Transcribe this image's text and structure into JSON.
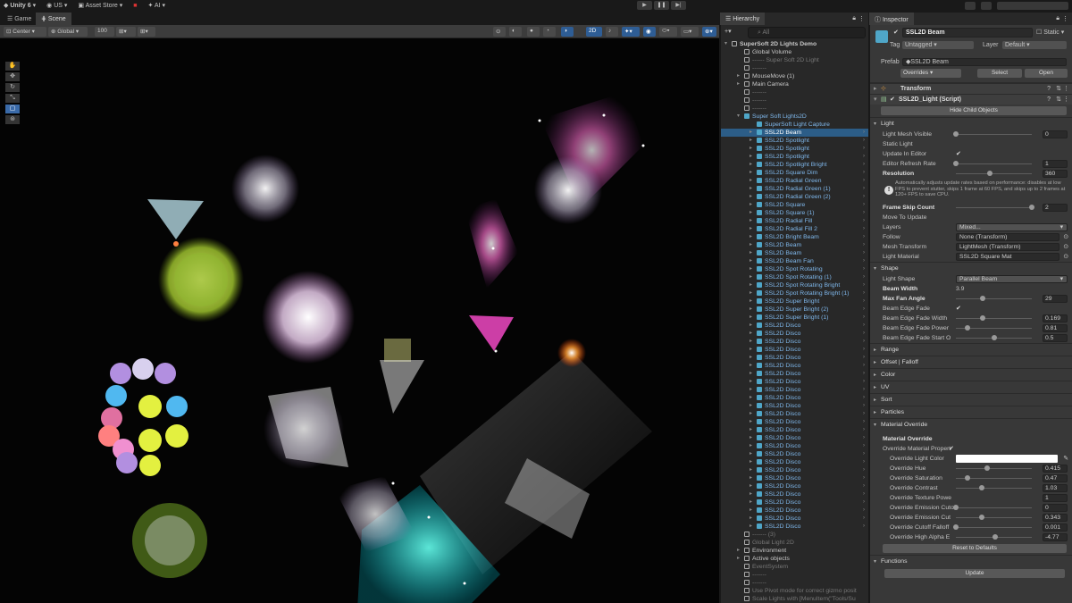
{
  "topbar": {
    "app": "Unity 6",
    "account": "US",
    "store": "Asset Store",
    "ai": "AI"
  },
  "tabs": {
    "game": "Game",
    "scene": "Scene"
  },
  "scene_toolbar": {
    "pivot": "Center",
    "space": "Global",
    "snap": "100",
    "mode2d": "2D"
  },
  "hierarchy": {
    "title": "Hierarchy",
    "search": "All",
    "rows": [
      {
        "t": "SuperSoft 2D Lights Demo",
        "d": 0,
        "k": "scene",
        "s": "root"
      },
      {
        "t": "Global Volume",
        "d": 1,
        "k": "go",
        "s": ""
      },
      {
        "t": "------ Super Soft 2D Light",
        "d": 1,
        "k": "go",
        "s": "gray"
      },
      {
        "t": "-------",
        "d": 1,
        "k": "go",
        "s": "gray"
      },
      {
        "t": "MouseMove (1)",
        "d": 1,
        "k": "go",
        "s": "arrow"
      },
      {
        "t": "Main Camera",
        "d": 1,
        "k": "go",
        "s": "arrow"
      },
      {
        "t": "-------",
        "d": 1,
        "k": "go",
        "s": "gray"
      },
      {
        "t": "-------",
        "d": 1,
        "k": "go",
        "s": "gray"
      },
      {
        "t": "-------",
        "d": 1,
        "k": "go",
        "s": "gray"
      },
      {
        "t": "Super Soft Lights2D",
        "d": 1,
        "k": "pf",
        "s": "blue open"
      },
      {
        "t": "SuperSoft Light Capture",
        "d": 2,
        "k": "pf",
        "s": "blue"
      },
      {
        "t": "SSL2D Beam",
        "d": 2,
        "k": "pf",
        "s": "sel arrow"
      },
      {
        "t": "SSL2D Spotlight",
        "d": 2,
        "k": "pf",
        "s": "blue arrow"
      },
      {
        "t": "SSL2D Spotlight",
        "d": 2,
        "k": "pf",
        "s": "blue arrow"
      },
      {
        "t": "SSL2D Spotlight",
        "d": 2,
        "k": "pf",
        "s": "blue arrow"
      },
      {
        "t": "SSL2D Spotlight Bright",
        "d": 2,
        "k": "pf",
        "s": "blue arrow"
      },
      {
        "t": "SSL2D Square Dim",
        "d": 2,
        "k": "pf",
        "s": "blue arrow"
      },
      {
        "t": "SSL2D Radial Green",
        "d": 2,
        "k": "pf",
        "s": "blue arrow"
      },
      {
        "t": "SSL2D Radial Green (1)",
        "d": 2,
        "k": "pf",
        "s": "blue arrow"
      },
      {
        "t": "SSL2D Radial Green (2)",
        "d": 2,
        "k": "pf",
        "s": "blue arrow"
      },
      {
        "t": "SSL2D Square",
        "d": 2,
        "k": "pf",
        "s": "blue arrow"
      },
      {
        "t": "SSL2D Square (1)",
        "d": 2,
        "k": "pf",
        "s": "blue arrow"
      },
      {
        "t": "SSL2D Radial Fill",
        "d": 2,
        "k": "pf",
        "s": "blue arrow"
      },
      {
        "t": "SSL2D Radial Fill 2",
        "d": 2,
        "k": "pf",
        "s": "blue arrow"
      },
      {
        "t": "SSL2D Bright Beam",
        "d": 2,
        "k": "pf",
        "s": "blue arrow"
      },
      {
        "t": "SSL2D Beam",
        "d": 2,
        "k": "pf",
        "s": "blue arrow"
      },
      {
        "t": "SSL2D Beam",
        "d": 2,
        "k": "pf",
        "s": "blue arrow"
      },
      {
        "t": "SSL2D Beam Fan",
        "d": 2,
        "k": "pf",
        "s": "blue arrow"
      },
      {
        "t": "SSL2D Spot Rotating",
        "d": 2,
        "k": "pf",
        "s": "blue arrow"
      },
      {
        "t": "SSL2D Spot Rotating (1)",
        "d": 2,
        "k": "pf",
        "s": "blue arrow"
      },
      {
        "t": "SSL2D Spot Rotating Bright",
        "d": 2,
        "k": "pf",
        "s": "blue arrow"
      },
      {
        "t": "SSL2D Spot Rotating Bright (1)",
        "d": 2,
        "k": "pf",
        "s": "blue arrow"
      },
      {
        "t": "SSL2D Super Bright",
        "d": 2,
        "k": "pf",
        "s": "blue arrow"
      },
      {
        "t": "SSL2D Super Bright (2)",
        "d": 2,
        "k": "pf",
        "s": "blue arrow"
      },
      {
        "t": "SSL2D Super Bright (1)",
        "d": 2,
        "k": "pf",
        "s": "blue arrow"
      },
      {
        "t": "SSL2D Disco",
        "d": 2,
        "k": "pf",
        "s": "blue arrow"
      },
      {
        "t": "SSL2D Disco",
        "d": 2,
        "k": "pf",
        "s": "blue arrow"
      },
      {
        "t": "SSL2D Disco",
        "d": 2,
        "k": "pf",
        "s": "blue arrow"
      },
      {
        "t": "SSL2D Disco",
        "d": 2,
        "k": "pf",
        "s": "blue arrow"
      },
      {
        "t": "SSL2D Disco",
        "d": 2,
        "k": "pf",
        "s": "blue arrow"
      },
      {
        "t": "SSL2D Disco",
        "d": 2,
        "k": "pf",
        "s": "blue arrow"
      },
      {
        "t": "SSL2D Disco",
        "d": 2,
        "k": "pf",
        "s": "blue arrow"
      },
      {
        "t": "SSL2D Disco",
        "d": 2,
        "k": "pf",
        "s": "blue arrow"
      },
      {
        "t": "SSL2D Disco",
        "d": 2,
        "k": "pf",
        "s": "blue arrow"
      },
      {
        "t": "SSL2D Disco",
        "d": 2,
        "k": "pf",
        "s": "blue arrow"
      },
      {
        "t": "SSL2D Disco",
        "d": 2,
        "k": "pf",
        "s": "blue arrow"
      },
      {
        "t": "SSL2D Disco",
        "d": 2,
        "k": "pf",
        "s": "blue arrow"
      },
      {
        "t": "SSL2D Disco",
        "d": 2,
        "k": "pf",
        "s": "blue arrow"
      },
      {
        "t": "SSL2D Disco",
        "d": 2,
        "k": "pf",
        "s": "blue arrow"
      },
      {
        "t": "SSL2D Disco",
        "d": 2,
        "k": "pf",
        "s": "blue arrow"
      },
      {
        "t": "SSL2D Disco",
        "d": 2,
        "k": "pf",
        "s": "blue arrow"
      },
      {
        "t": "SSL2D Disco",
        "d": 2,
        "k": "pf",
        "s": "blue arrow"
      },
      {
        "t": "SSL2D Disco",
        "d": 2,
        "k": "pf",
        "s": "blue arrow"
      },
      {
        "t": "SSL2D Disco",
        "d": 2,
        "k": "pf",
        "s": "blue arrow"
      },
      {
        "t": "SSL2D Disco",
        "d": 2,
        "k": "pf",
        "s": "blue arrow"
      },
      {
        "t": "SSL2D Disco",
        "d": 2,
        "k": "pf",
        "s": "blue arrow"
      },
      {
        "t": "SSL2D Disco",
        "d": 2,
        "k": "pf",
        "s": "blue arrow"
      },
      {
        "t": "SSL2D Disco",
        "d": 2,
        "k": "pf",
        "s": "blue arrow"
      },
      {
        "t": "SSL2D Disco",
        "d": 2,
        "k": "pf",
        "s": "blue arrow"
      },
      {
        "t": "SSL2D Disco",
        "d": 2,
        "k": "pf",
        "s": "blue arrow"
      },
      {
        "t": "SSL2D Disco",
        "d": 2,
        "k": "pf",
        "s": "blue arrow"
      },
      {
        "t": "------- (3)",
        "d": 1,
        "k": "go",
        "s": "gray"
      },
      {
        "t": "Global Light 2D",
        "d": 1,
        "k": "go",
        "s": "gray"
      },
      {
        "t": "Environment",
        "d": 1,
        "k": "go",
        "s": "arrow"
      },
      {
        "t": "Active objects",
        "d": 1,
        "k": "go",
        "s": "arrow"
      },
      {
        "t": "EventSystem",
        "d": 1,
        "k": "go",
        "s": "gray"
      },
      {
        "t": "-------",
        "d": 1,
        "k": "go",
        "s": "gray"
      },
      {
        "t": "-------",
        "d": 1,
        "k": "go",
        "s": "gray"
      },
      {
        "t": "Use Pivot mode for correct gizmo posit",
        "d": 1,
        "k": "go",
        "s": "gray"
      },
      {
        "t": "Scale Lights with [MenuItem(\"Tools/Su",
        "d": 1,
        "k": "go",
        "s": "gray"
      },
      {
        "t": "-------",
        "d": 1,
        "k": "go",
        "s": "gray"
      }
    ]
  },
  "inspector": {
    "title": "Inspector",
    "obj_name": "SSL2D Beam",
    "static_label": "Static",
    "tag_label": "Tag",
    "tag": "Untagged",
    "layer_label": "Layer",
    "layer": "Default",
    "prefab_label": "Prefab",
    "prefab": "SSL2D Beam",
    "overrides": "Overrides",
    "select": "Select",
    "open": "Open",
    "transform": "Transform",
    "script": "SSL2D_Light (Script)",
    "hide_child": "Hide Child Objects",
    "light_section": "Light",
    "light_mesh_visible": "Light Mesh Visible",
    "light_mesh_visible_v": "0",
    "light_mesh_visible_f": 0.0,
    "static_light": "Static Light",
    "update_in_editor": "Update In Editor",
    "editor_refresh_rate": "Editor Refresh Rate",
    "editor_refresh_rate_v": "1",
    "editor_refresh_rate_f": 0.0,
    "resolution": "Resolution",
    "resolution_v": "360",
    "resolution_f": 0.45,
    "note": "Automatically adjusts update rates based on performance: disables at low FPS to prevent stutter, skips 1 frame at 60 FPS, and skips up to 2 frames at 120+ FPS to save CPU.",
    "frame_skip": "Frame Skip Count",
    "frame_skip_v": "2",
    "frame_skip_f": 1.0,
    "move_to_update": "Move To Update",
    "layers": "Layers",
    "layers_v": "Mixed...",
    "follow": "Follow",
    "follow_v": "None (Transform)",
    "mesh_transform": "Mesh Transform",
    "mesh_transform_v": "LightMesh (Transform)",
    "light_material": "Light Material",
    "light_material_v": "SSL2D Square Mat",
    "shape_section": "Shape",
    "light_shape": "Light Shape",
    "light_shape_v": "Parallel Beam",
    "beam_width": "Beam Width",
    "beam_width_v": "3.9",
    "max_fan": "Max Fan Angle",
    "max_fan_v": "29",
    "max_fan_f": 0.35,
    "beam_edge_fade": "Beam Edge Fade",
    "bef_width": "Beam Edge Fade Width",
    "bef_width_v": "0.169",
    "bef_width_f": 0.35,
    "bef_power": "Beam Edge Fade Power",
    "bef_power_v": "0.81",
    "bef_power_f": 0.15,
    "bef_start": "Beam Edge Fade Start O",
    "bef_start_v": "0.5",
    "bef_start_f": 0.5,
    "range": "Range",
    "offset": "Offset | Falloff",
    "color": "Color",
    "uv": "UV",
    "sort": "Sort",
    "particles": "Particles",
    "mat_override_section": "Material Override",
    "mat_override_sub": "Material Override",
    "override_mat_prop": "Override Material Propert",
    "o_color": "Override Light Color",
    "o_color_hex": "#ffffff",
    "o_hue": "Override Hue",
    "o_hue_v": "0.415",
    "o_hue_f": 0.415,
    "o_sat": "Override Saturation",
    "o_sat_v": "0.47",
    "o_sat_f": 0.15,
    "o_con": "Override Contrast",
    "o_con_v": "1.03",
    "o_con_f": 0.34,
    "o_tex": "Override Texture Powe",
    "o_tex_v": "1",
    "o_em_cut": "Override Emission Cuto",
    "o_em_cut_v": "0",
    "o_em_cut_f": 0.0,
    "o_em_cut2": "Override Emission Cut",
    "o_em_cut2_v": "0.343",
    "o_em_cut2_f": 0.343,
    "o_cutoff": "Override Cutoff Falloff",
    "o_cutoff_v": "0.001",
    "o_cutoff_f": 0.0,
    "o_high": "Override High Alpha E",
    "o_high_v": "-4.77",
    "o_high_f": 0.52,
    "reset": "Reset to Defaults",
    "functions": "Functions",
    "update": "Update"
  }
}
